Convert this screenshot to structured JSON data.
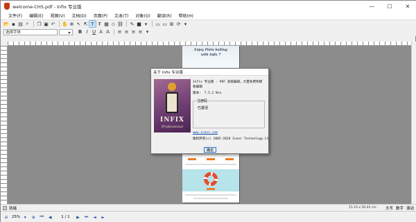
{
  "window": {
    "title": "welcome-CHS.pdf - Infix 专业版",
    "controls": [
      "—",
      "☐",
      "✕"
    ]
  },
  "menu": [
    "文件(F)",
    "编辑(E)",
    "视图(V)",
    "文档(D)",
    "页面(P)",
    "文本(T)",
    "对象(O)",
    "翻译(R)",
    "帮助(H)"
  ],
  "toolbar2": {
    "font_placeholder": "选择字体"
  },
  "dialog": {
    "title": "关于 Infix 专业版",
    "product_line1": "Infix 专业版 - PDF 高级编辑，大量免费和模",
    "product_line2": "板编辑",
    "version_label": "版本：",
    "version_value": "7.5.2 Win",
    "registration_label": "注册码",
    "registration_value": "已激活",
    "url": "www.iceni.com",
    "copyright": "版权所有(c) 2005-2020 Iceni Technology Lt",
    "ok_label": "确定",
    "logo_text": "INFIX",
    "logo_sub": "Professional"
  },
  "page_preview": {
    "hero_line1": "Enjoy Plain Sailing",
    "hero_line2": "with Infix 7"
  },
  "statusbar": {
    "mode": "就绪",
    "coords": "15.19 x 56.03 cm",
    "indicators": [
      "大写",
      "数字",
      "滚动"
    ]
  },
  "bottombar": {
    "zoom": "25%",
    "page": "1 / 1"
  }
}
